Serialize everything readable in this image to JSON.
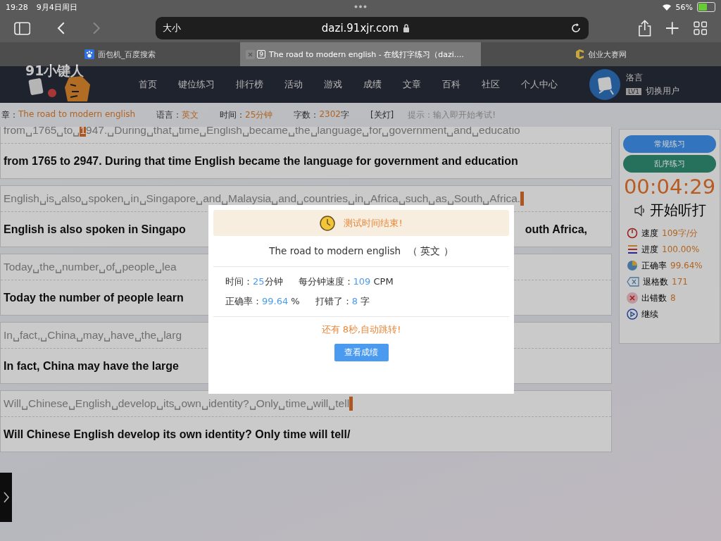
{
  "status_bar": {
    "time": "19:28",
    "date": "9月4日周日",
    "battery": "56%"
  },
  "browser": {
    "text_size": "大小",
    "url": "dazi.91xjr.com",
    "tabs": [
      {
        "title": "面包机_百度搜索",
        "selected": false
      },
      {
        "title": "The road to modern english - 在线打字练习（dazi....",
        "selected": true,
        "badge": "9"
      },
      {
        "title": "创业大赛网",
        "selected": false
      }
    ]
  },
  "site": {
    "logo": "91小键人",
    "nav": [
      "首页",
      "键位练习",
      "排行榜",
      "活动",
      "游戏",
      "成绩",
      "文章",
      "百科",
      "社区",
      "个人中心"
    ],
    "user": {
      "name": "洛言",
      "level": "LV1",
      "switch": "切换用户"
    }
  },
  "info": {
    "items": [
      {
        "label": "章：",
        "value": "The road to modern english"
      },
      {
        "label": "语言：",
        "value": "英文"
      },
      {
        "label": "时间：",
        "value": "25分钟"
      },
      {
        "label": "字数：",
        "value": "2302",
        "unit": "字"
      }
    ],
    "light": "[关灯]",
    "hint": "提示：输入即开始考试!"
  },
  "rows": [
    {
      "source": [
        {
          "text": "from␣1765␣to␣",
          "error": false
        },
        {
          "text": "1",
          "error": true
        },
        {
          "text": "947.␣During␣that␣time␣English␣became␣the␣language␣for␣government␣and␣educatio",
          "error": false
        }
      ],
      "end_mark": false,
      "typed": [
        "from 1765 to 2947. During that time English became the language for government and education"
      ]
    },
    {
      "source": [
        {
          "text": "English␣is␣also␣spoken␣in␣Singapore␣and␣Malaysia␣and␣countries␣in␣Africa␣such␣as␣South␣Africa.",
          "error": false
        }
      ],
      "end_mark": true,
      "typed": [
        "English is also spoken in Singapo",
        "outh Africa,"
      ]
    },
    {
      "source": [
        {
          "text": "Today␣the␣number␣of␣people␣lea",
          "error": false
        }
      ],
      "end_mark": false,
      "typed": [
        "Today the number of people learn"
      ]
    },
    {
      "source": [
        {
          "text": "In␣fact,␣China␣may␣have␣the␣larg",
          "error": false
        }
      ],
      "end_mark": false,
      "typed": [
        "In fact, China may have the large"
      ]
    },
    {
      "source": [
        {
          "text": "Will␣Chinese␣English␣develop␣its␣own␣identity?␣Only␣time␣will␣tell",
          "error": false
        }
      ],
      "end_mark": true,
      "typed": [
        "Will Chinese English develop its own identity? Only time will tell/"
      ]
    }
  ],
  "panel": {
    "buttons": [
      {
        "label": "常规练习",
        "kind": "regular"
      },
      {
        "label": "乱序练习",
        "kind": "shuffle"
      }
    ],
    "timer": "00:04:29",
    "listen": "开始听打",
    "stats": [
      {
        "kind": "speed",
        "label": "速度",
        "value": "109字/分"
      },
      {
        "kind": "progress",
        "label": "进度",
        "value": "100.00%"
      },
      {
        "kind": "accuracy",
        "label": "正确率",
        "value": "99.64%"
      },
      {
        "kind": "backspace",
        "label": "退格数",
        "value": "171"
      },
      {
        "kind": "errors",
        "label": "出错数",
        "value": "8"
      }
    ],
    "continue": "继续"
  },
  "modal": {
    "banner": "测试时间结束!",
    "title": "The road to modern english",
    "language": "（ 英文 ）",
    "stats": [
      [
        {
          "label": "时间：",
          "value": "25",
          "unit": "分钟"
        },
        {
          "label": "每分钟速度：",
          "value": "109",
          "unit": " CPM"
        }
      ],
      [
        {
          "label": "正确率：",
          "value": "99.64",
          "unit": " %"
        },
        {
          "label": "打错了：",
          "value": "8",
          "unit": " 字"
        }
      ]
    ],
    "countdown": "还有 8秒,自动跳转!",
    "button": "查看成绩"
  }
}
